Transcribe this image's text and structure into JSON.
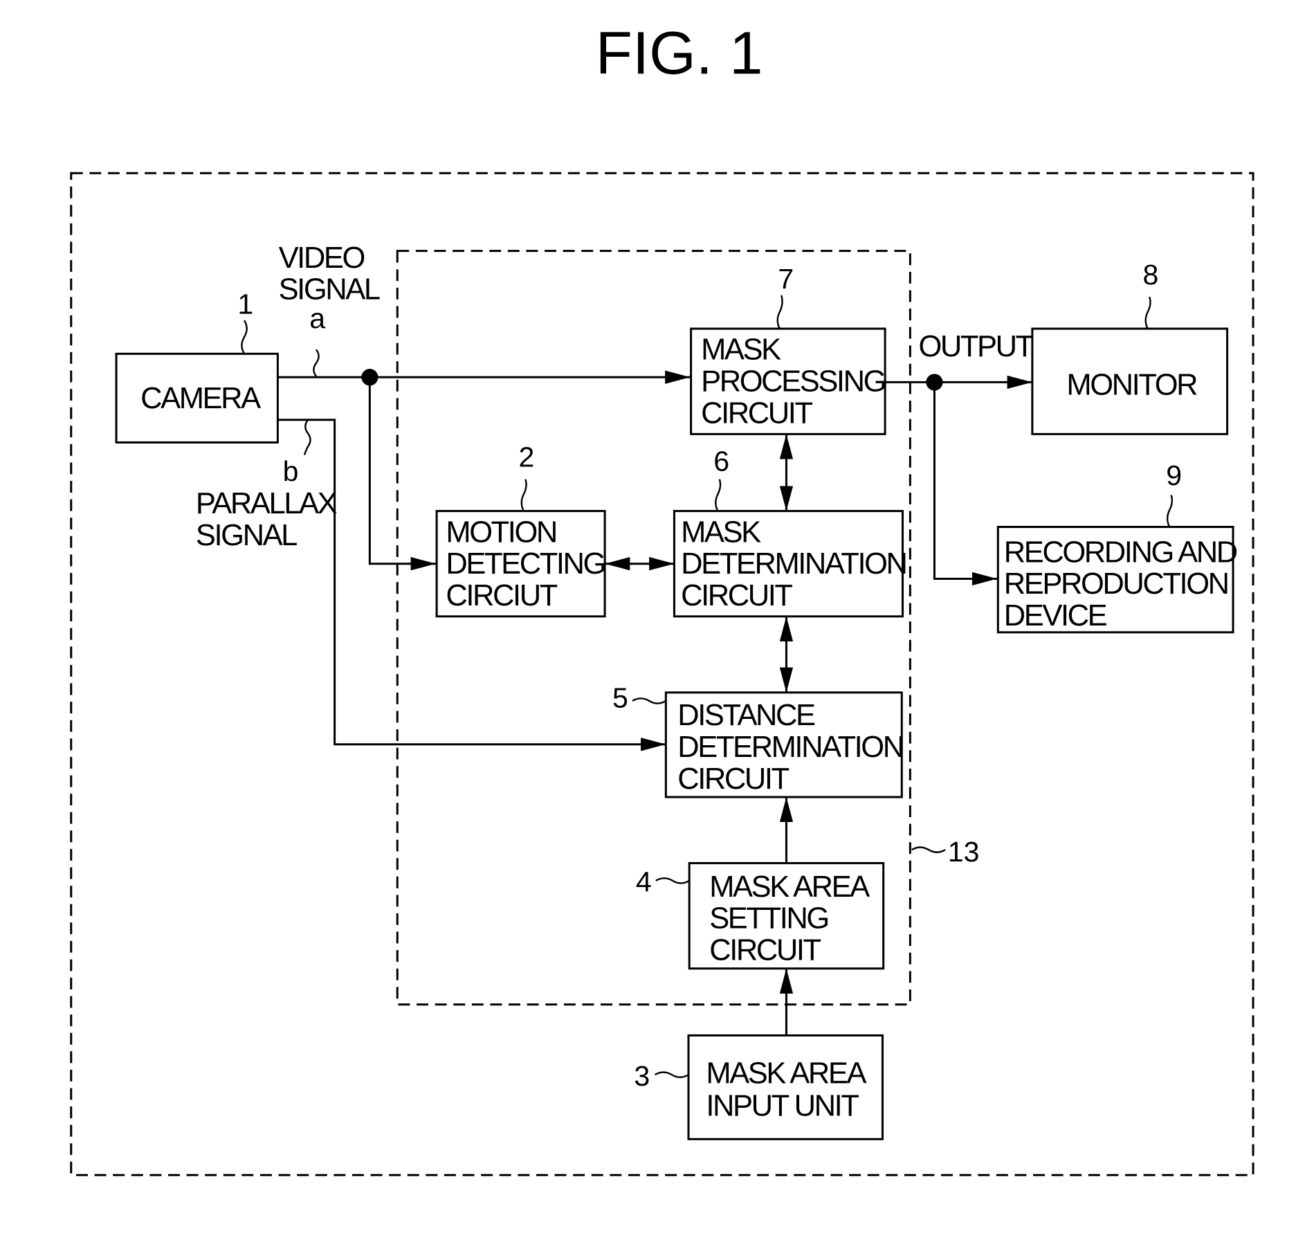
{
  "figure": {
    "title": "FIG. 1"
  },
  "blocks": {
    "camera": {
      "ref": "1",
      "lines": [
        "CAMERA"
      ]
    },
    "motion_detecting": {
      "ref": "2",
      "lines": [
        "MOTION",
        "DETECTING",
        "CIRCIUT"
      ]
    },
    "mask_area_input": {
      "ref": "3",
      "lines": [
        "MASK AREA",
        "INPUT UNIT"
      ]
    },
    "mask_area_setting": {
      "ref": "4",
      "lines": [
        "MASK AREA",
        "SETTING",
        "CIRCUIT"
      ]
    },
    "distance_determination": {
      "ref": "5",
      "lines": [
        "DISTANCE",
        "DETERMINATION",
        "CIRCUIT"
      ]
    },
    "mask_determination": {
      "ref": "6",
      "lines": [
        "MASK",
        "DETERMINATION",
        "CIRCUIT"
      ]
    },
    "mask_processing": {
      "ref": "7",
      "lines": [
        "MASK",
        "PROCESSING",
        "CIRCUIT"
      ]
    },
    "monitor": {
      "ref": "8",
      "lines": [
        "MONITOR"
      ]
    },
    "recording": {
      "ref": "9",
      "lines": [
        "RECORDING AND",
        "REPRODUCTION",
        "DEVICE"
      ]
    }
  },
  "signals": {
    "video": {
      "lines": [
        "VIDEO",
        "SIGNAL"
      ],
      "tag": "a"
    },
    "parallax": {
      "lines": [
        "PARALLAX",
        "SIGNAL"
      ],
      "tag": "b"
    },
    "output": "OUTPUT"
  },
  "groups": {
    "processing_unit_ref": "13"
  },
  "connections": [
    {
      "from": "camera",
      "to": "mask_processing",
      "label": "video signal a"
    },
    {
      "from": "camera",
      "to": "motion_detecting",
      "label": "video signal a"
    },
    {
      "from": "camera",
      "to": "distance_determination",
      "label": "parallax signal b"
    },
    {
      "from": "motion_detecting",
      "to": "mask_determination",
      "bidirectional": true
    },
    {
      "from": "mask_determination",
      "to": "mask_processing",
      "bidirectional": true
    },
    {
      "from": "mask_determination",
      "to": "distance_determination",
      "bidirectional": true
    },
    {
      "from": "mask_area_setting",
      "to": "distance_determination"
    },
    {
      "from": "mask_area_input",
      "to": "mask_area_setting"
    },
    {
      "from": "mask_processing",
      "to": "monitor",
      "label": "output"
    },
    {
      "from": "mask_processing",
      "to": "recording",
      "label": "output"
    }
  ]
}
